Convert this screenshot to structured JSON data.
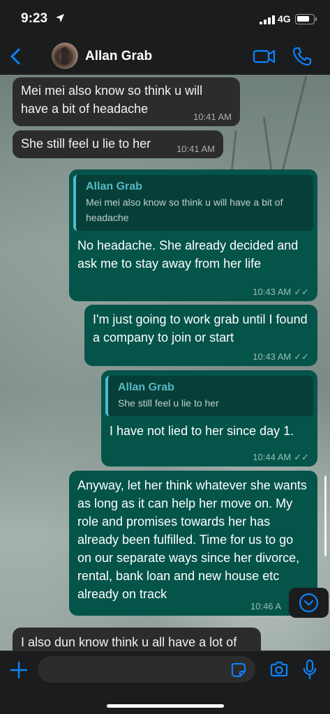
{
  "status_bar": {
    "time": "9:23",
    "network": "4G",
    "battery_level": 0.8
  },
  "header": {
    "contact_name": "Allan Grab",
    "accent_color": "#0a84ff",
    "icons": [
      "back-chevron-icon",
      "video-call-icon",
      "phone-icon"
    ]
  },
  "messages": [
    {
      "direction": "in",
      "text": "Mei mei also know so think u will have a bit of headache",
      "time": "10:41 AM"
    },
    {
      "direction": "in",
      "text": "She still feel u lie to her",
      "time": "10:41 AM"
    },
    {
      "direction": "out",
      "quote_name": "Allan Grab",
      "quote_text": "Mei mei also know so think u will have a bit of headache",
      "text": "No headache. She already decided and ask me to stay away from her life",
      "time": "10:43 AM"
    },
    {
      "direction": "out",
      "text": "I'm just going to work grab until I found a company to join or start",
      "time": "10:43 AM"
    },
    {
      "direction": "out",
      "quote_name": "Allan Grab",
      "quote_text": "She still feel u lie to her",
      "text": "I have not lied to her since day 1.",
      "time": "10:44 AM"
    },
    {
      "direction": "out",
      "text": "Anyway, let her think whatever she wants as long as it can help her move on. My role and promises towards her has already been fulfilled. Time for us to go on our separate ways since her divorce, rental, bank loan and new house etc already on track",
      "time": "10:46 A"
    },
    {
      "direction": "in",
      "text": "I also dun know think u all have a lot of"
    }
  ],
  "input": {
    "value": "",
    "placeholder": ""
  },
  "colors": {
    "outgoing_bubble": "#04544a",
    "incoming_bubble": "#2c2c2e",
    "quote_accent": "#52b8cc"
  }
}
